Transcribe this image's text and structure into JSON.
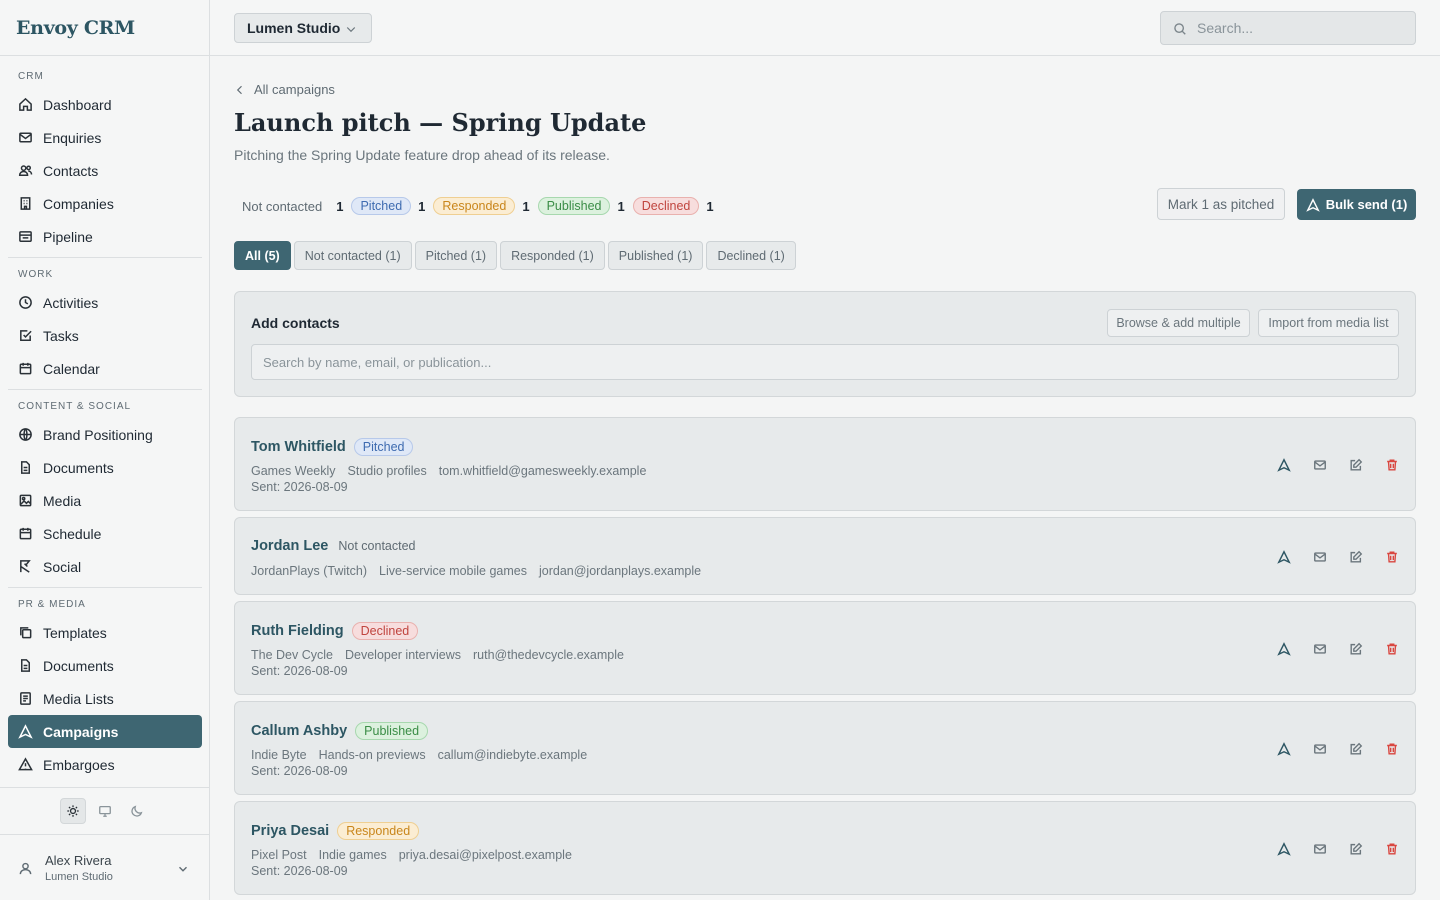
{
  "app": {
    "name": "Envoy CRM"
  },
  "sidebar": {
    "sections": [
      {
        "label": "CRM",
        "items": [
          "Dashboard",
          "Enquiries",
          "Contacts",
          "Companies",
          "Pipeline"
        ]
      },
      {
        "label": "WORK",
        "items": [
          "Activities",
          "Tasks",
          "Calendar"
        ]
      },
      {
        "label": "CONTENT & SOCIAL",
        "items": [
          "Brand Positioning",
          "Documents",
          "Media",
          "Schedule",
          "Social"
        ]
      },
      {
        "label": "PR & MEDIA",
        "items": [
          "Templates",
          "Documents",
          "Media Lists",
          "Campaigns",
          "Embargoes"
        ]
      }
    ],
    "active_item": "Campaigns",
    "theme_modes": [
      "light",
      "system",
      "dark"
    ],
    "theme_selected": "light",
    "user": {
      "name": "Alex Rivera",
      "org": "Lumen Studio"
    }
  },
  "topbar": {
    "org": "Lumen Studio",
    "search_placeholder": "Search..."
  },
  "page": {
    "back_label": "All campaigns",
    "title": "Launch pitch — Spring Update",
    "subtitle": "Pitching the Spring Update feature drop ahead of its release."
  },
  "summary": {
    "not_contacted": {
      "label": "Not contacted",
      "count": "1"
    },
    "pitched": {
      "label": "Pitched",
      "count": "1"
    },
    "responded": {
      "label": "Responded",
      "count": "1"
    },
    "published": {
      "label": "Published",
      "count": "1"
    },
    "declined": {
      "label": "Declined",
      "count": "1"
    }
  },
  "actions": {
    "mark_pitched": "Mark 1 as pitched",
    "bulk_send": "Bulk send (1)"
  },
  "tabs": [
    {
      "label": "All (5)",
      "active": true
    },
    {
      "label": "Not contacted (1)",
      "active": false
    },
    {
      "label": "Pitched (1)",
      "active": false
    },
    {
      "label": "Responded (1)",
      "active": false
    },
    {
      "label": "Published (1)",
      "active": false
    },
    {
      "label": "Declined (1)",
      "active": false
    }
  ],
  "add_contacts": {
    "title": "Add contacts",
    "browse_label": "Browse & add multiple",
    "import_label": "Import from media list",
    "search_placeholder": "Search by name, email, or publication..."
  },
  "contacts": [
    {
      "name": "Tom Whitfield",
      "status": "Pitched",
      "publication": "Games Weekly",
      "beat": "Studio profiles",
      "email": "tom.whitfield@gamesweekly.example",
      "sent": "Sent: 2026-08-09"
    },
    {
      "name": "Jordan Lee",
      "status": "Not contacted",
      "publication": "JordanPlays (Twitch)",
      "beat": "Live-service mobile games",
      "email": "jordan@jordanplays.example",
      "sent": ""
    },
    {
      "name": "Ruth Fielding",
      "status": "Declined",
      "publication": "The Dev Cycle",
      "beat": "Developer interviews",
      "email": "ruth@thedevcycle.example",
      "sent": "Sent: 2026-08-09"
    },
    {
      "name": "Callum Ashby",
      "status": "Published",
      "publication": "Indie Byte",
      "beat": "Hands-on previews",
      "email": "callum@indiebyte.example",
      "sent": "Sent: 2026-08-09"
    },
    {
      "name": "Priya Desai",
      "status": "Responded",
      "publication": "Pixel Post",
      "beat": "Indie games",
      "email": "priya.desai@pixelpost.example",
      "sent": "Sent: 2026-08-09"
    }
  ],
  "colors": {
    "accent": "#3e6672",
    "danger": "#d9463f"
  }
}
